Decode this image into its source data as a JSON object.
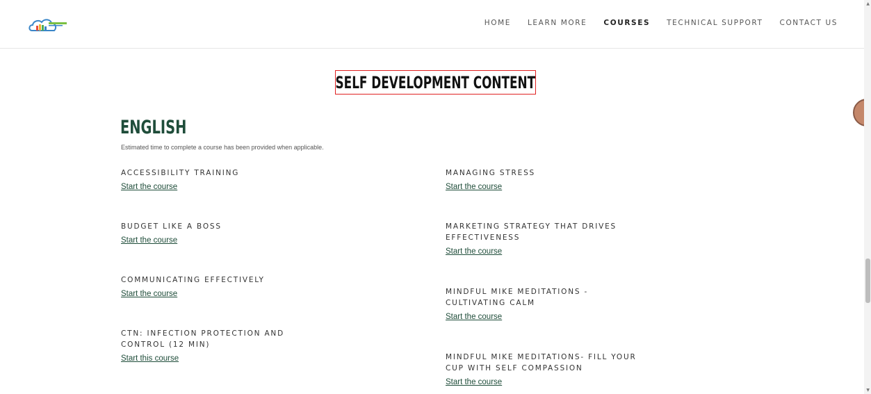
{
  "header": {
    "nav": [
      "HOME",
      "LEARN MORE",
      "COURSES",
      "TECHNICAL SUPPORT",
      "CONTACT US"
    ],
    "active_nav": "COURSES",
    "logo_icon": "cloud-library-logo-icon"
  },
  "page": {
    "title": "SELF DEVELOPMENT CONTENT"
  },
  "section": {
    "heading": "ENGLISH",
    "note": "Estimated time to complete a course has been provided when applicable."
  },
  "courses_left": [
    {
      "name": "ACCESSIBILITY TRAINING",
      "link": "Start the course"
    },
    {
      "name": "BUDGET LIKE A BOSS",
      "link": "Start the course"
    },
    {
      "name": "COMMUNICATING EFFECTIVELY",
      "link": "Start the course"
    },
    {
      "name": "CTN: INFECTION PROTECTION AND CONTROL (12 MIN)",
      "link": "Start this course"
    }
  ],
  "courses_right": [
    {
      "name": "MANAGING STRESS",
      "link": "Start the course"
    },
    {
      "name": "MARKETING STRATEGY THAT DRIVES EFFECTIVENESS",
      "link": "Start the course"
    },
    {
      "name": "MINDFUL MIKE MEDITATIONS - CULTIVATING CALM",
      "link": "Start the course"
    },
    {
      "name": "MINDFUL MIKE MEDITATIONS- FILL YOUR CUP WITH SELF COMPASSION",
      "link": "Start the course"
    }
  ],
  "colors": {
    "accent": "#1f4d3a",
    "title_border": "#e02020"
  }
}
